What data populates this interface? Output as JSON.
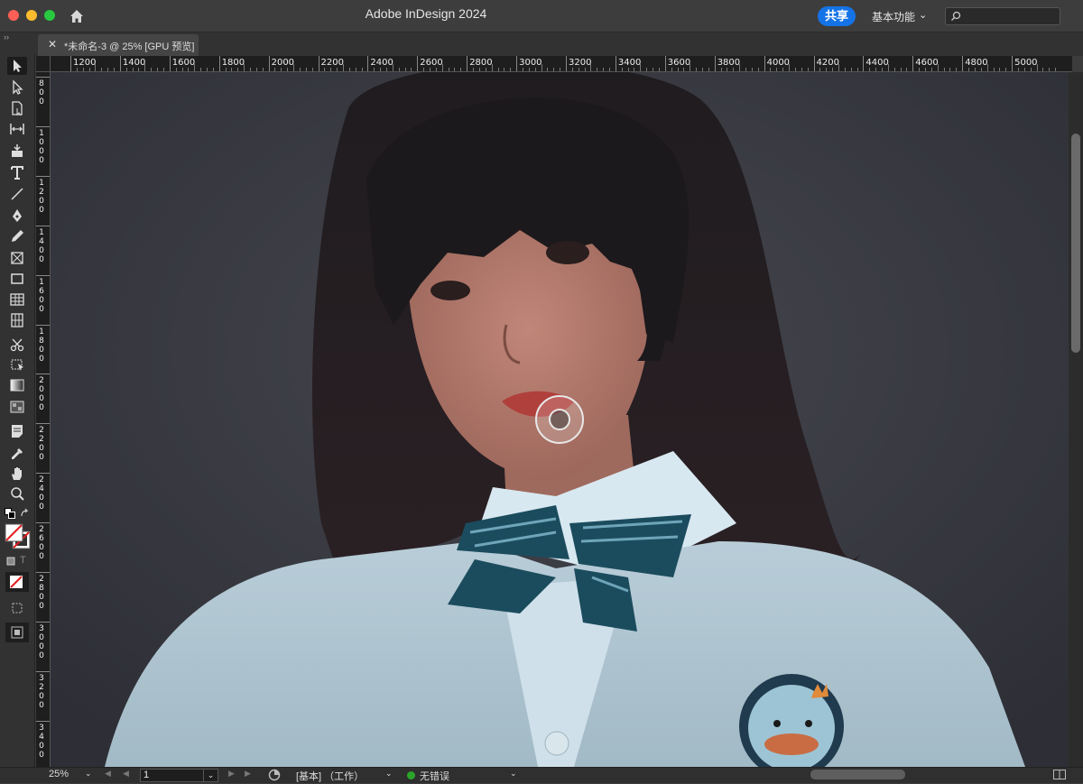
{
  "window": {
    "app_title": "Adobe InDesign 2024",
    "share_label": "共享",
    "workspace_label": "基本功能",
    "workspace_chevron": "⌄",
    "traffic_colors": [
      "#ff5f57",
      "#febc2e",
      "#28c840"
    ]
  },
  "tabs": [
    {
      "title": "*未命名-3 @ 25% [GPU 预览]",
      "close": "✕"
    }
  ],
  "panel_collapse": "››",
  "ruler_top": [
    "1200",
    "1400",
    "1600",
    "1800",
    "2000",
    "2200",
    "2400",
    "2600",
    "2800",
    "3000",
    "3200",
    "3400",
    "3600",
    "3800",
    "4000",
    "4200",
    "4400",
    "4600",
    "4800",
    "5000"
  ],
  "ruler_left": [
    "800",
    "1000",
    "1200",
    "1400",
    "1600",
    "1800",
    "2000",
    "2200",
    "2400",
    "2600",
    "2800",
    "3000",
    "3200",
    "3400"
  ],
  "tools": [
    "selection-tool-icon",
    "direct-selection-tool-icon",
    "page-tool-icon",
    "gap-tool-icon",
    "content-collector-icon",
    "type-tool-icon",
    "line-tool-icon",
    "pen-tool-icon",
    "pencil-tool-icon",
    "rectangle-frame-tool-icon",
    "rectangle-tool-icon",
    "table-tool-icon",
    "grid-tool-icon",
    "scissors-tool-icon",
    "free-transform-tool-icon",
    "gradient-swatch-tool-icon",
    "gradient-feather-tool-icon",
    "note-tool-icon",
    "eyedropper-tool-icon",
    "hand-tool-icon",
    "zoom-tool-icon"
  ],
  "status": {
    "zoom": "25%",
    "page": "1",
    "preflight_profile": "[基本] （工作）",
    "errors": "无错误",
    "error_color": "#2aa52a"
  }
}
